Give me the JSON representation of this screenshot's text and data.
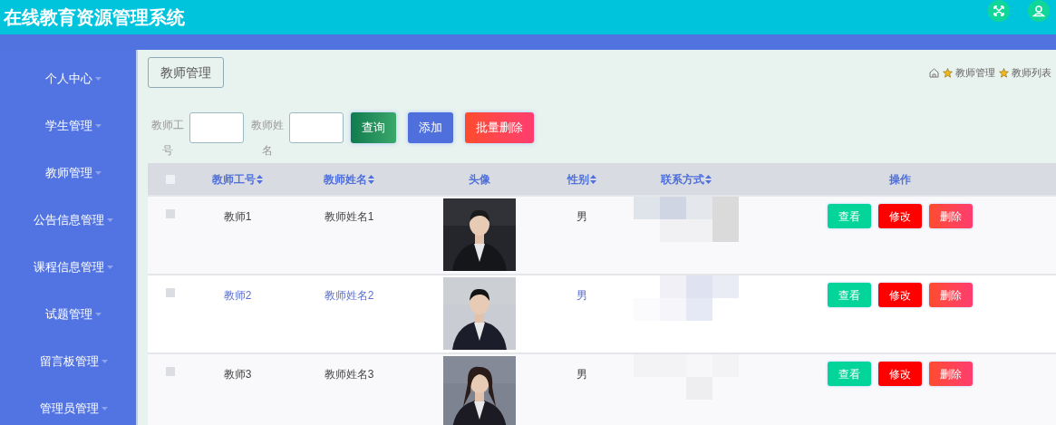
{
  "header": {
    "title": "在线教育资源管理系统"
  },
  "sidebar": {
    "items": [
      {
        "label": "个人中心"
      },
      {
        "label": "学生管理"
      },
      {
        "label": "教师管理"
      },
      {
        "label": "公告信息管理"
      },
      {
        "label": "课程信息管理"
      },
      {
        "label": "试题管理"
      },
      {
        "label": "留言板管理"
      },
      {
        "label": "管理员管理"
      }
    ]
  },
  "page_title": "教师管理",
  "breadcrumb": [
    "教师管理",
    "教师列表"
  ],
  "search": {
    "fields": [
      {
        "label": "教师工号"
      },
      {
        "label": "教师姓名"
      }
    ],
    "buttons": [
      {
        "label": "查询",
        "kind": "query"
      },
      {
        "label": "添加",
        "kind": "add"
      },
      {
        "label": "批量删除",
        "kind": "delete"
      }
    ]
  },
  "table": {
    "select_all_checked": false,
    "columns": [
      {
        "label": "教师工号",
        "sortable": true
      },
      {
        "label": "教师姓名",
        "sortable": true
      },
      {
        "label": "头像",
        "sortable": false
      },
      {
        "label": "性别",
        "sortable": true
      },
      {
        "label": "联系方式",
        "sortable": true
      },
      {
        "label": "操作",
        "sortable": false
      }
    ],
    "rows": [
      {
        "checked": false,
        "hovered": false,
        "id": "教师1",
        "name": "教师姓名1",
        "gender": "男",
        "actions": [
          {
            "label": "查看",
            "kind": "view"
          },
          {
            "label": "修改",
            "kind": "edit"
          },
          {
            "label": "删除",
            "kind": "delete"
          }
        ]
      },
      {
        "checked": false,
        "hovered": true,
        "id": "教师2",
        "name": "教师姓名2",
        "gender": "男",
        "actions": [
          {
            "label": "查看",
            "kind": "view"
          },
          {
            "label": "修改",
            "kind": "edit"
          },
          {
            "label": "删除",
            "kind": "delete"
          }
        ]
      },
      {
        "checked": false,
        "hovered": false,
        "id": "教师3",
        "name": "教师姓名3",
        "gender": "男",
        "actions": [
          {
            "label": "查看",
            "kind": "view"
          },
          {
            "label": "修改",
            "kind": "edit"
          },
          {
            "label": "删除",
            "kind": "delete"
          }
        ]
      }
    ]
  }
}
